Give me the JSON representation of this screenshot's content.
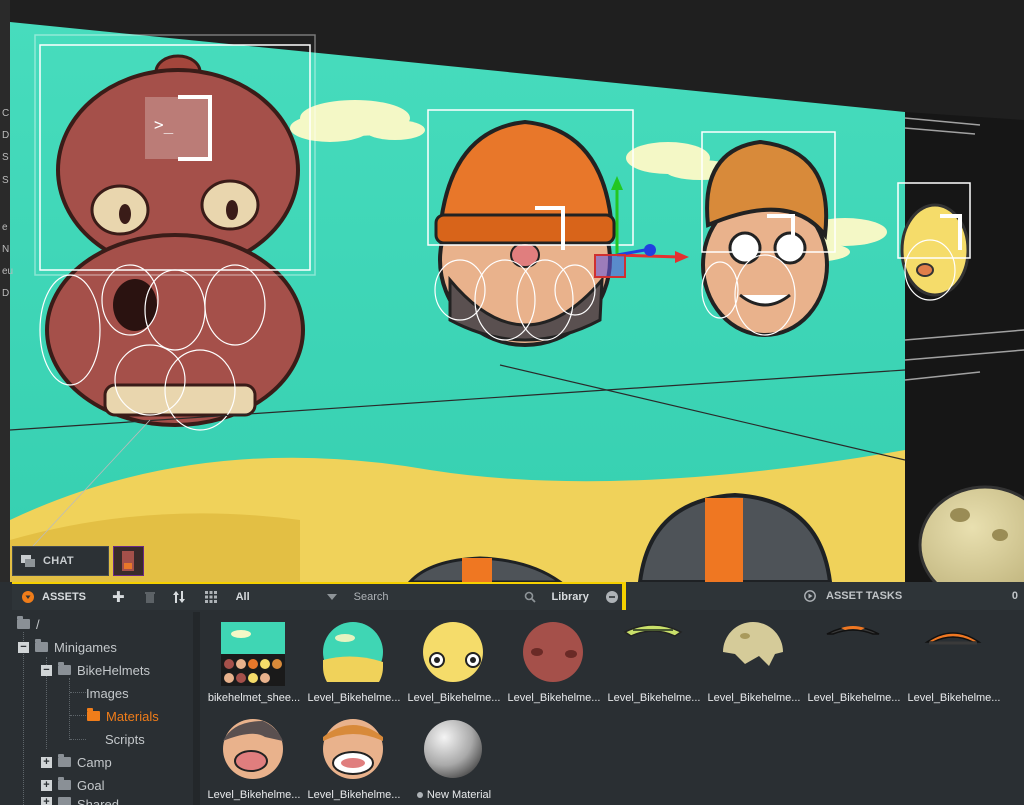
{
  "viewport": {
    "left_strip_letters": [
      "C",
      "D",
      "S",
      "S",
      "e",
      "N",
      "eu",
      "D"
    ]
  },
  "chat": {
    "label": "CHAT"
  },
  "assets": {
    "title": "ASSETS",
    "filter": "All",
    "search_placeholder": "Search",
    "library_label": "Library"
  },
  "asset_tasks": {
    "title": "ASSET TASKS",
    "count": "0"
  },
  "tree": {
    "root": "/",
    "items": [
      {
        "label": "Minigames"
      },
      {
        "label": "BikeHelmets"
      },
      {
        "label": "Images"
      },
      {
        "label": "Materials"
      },
      {
        "label": "Scripts"
      },
      {
        "label": "Camp"
      },
      {
        "label": "Goal"
      },
      {
        "label": "Shared"
      }
    ]
  },
  "grid": {
    "items": [
      {
        "label": "bikehelmet_shee..."
      },
      {
        "label": "Level_Bikehelme..."
      },
      {
        "label": "Level_Bikehelme..."
      },
      {
        "label": "Level_Bikehelme..."
      },
      {
        "label": "Level_Bikehelme..."
      },
      {
        "label": "Level_Bikehelme..."
      },
      {
        "label": "Level_Bikehelme..."
      },
      {
        "label": "Level_Bikehelme..."
      },
      {
        "label": "Level_Bikehelme..."
      },
      {
        "label": "Level_Bikehelme..."
      },
      {
        "label": "New Material"
      }
    ]
  },
  "colors": {
    "accent": "#f5d000",
    "active_folder": "#f07d1a",
    "scene_sky": "#3fd6b4",
    "scene_sand": "#f0d25a"
  }
}
